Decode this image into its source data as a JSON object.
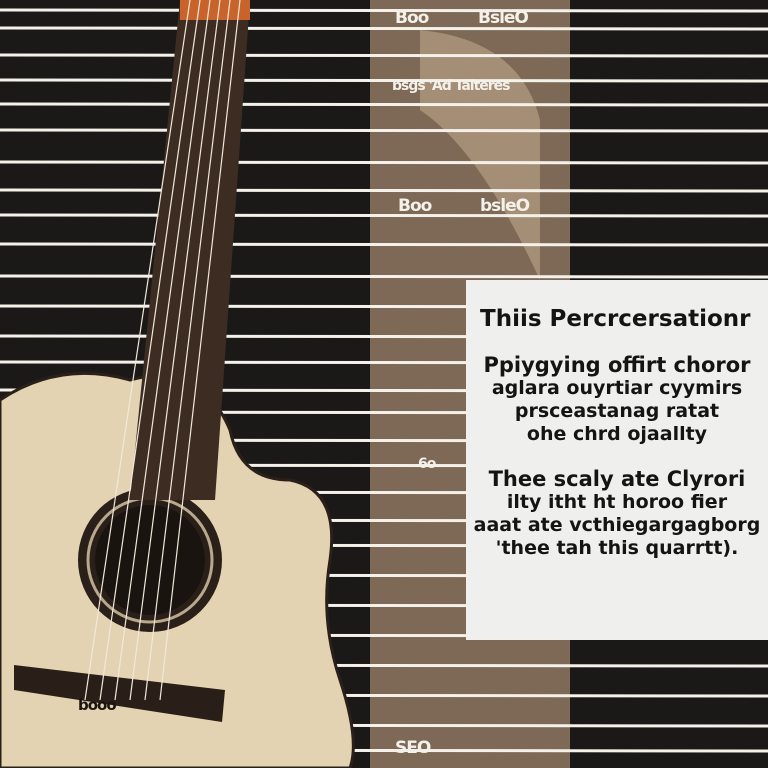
{
  "staff_labels": [
    "Boo",
    "BsleO",
    "bsgs 'Ad Taiteres",
    "Boo",
    "bsleO",
    "6o",
    "booo",
    "SEO"
  ],
  "panel": {
    "title": "Thiis Percrcersationr",
    "paragraph1": [
      "Ppiygying  offirt choror",
      "aglara  ouyrtiar cyymirs",
      "prsceastanag ratat",
      "ohe chrd  ojaallty"
    ],
    "paragraph2": [
      "Thee scaly ate  Clyrori",
      "ilty itht ht horoo fier",
      "aaat ate vcthiegargagborg",
      "'thee tah this quarrtt)."
    ]
  },
  "colors": {
    "background": "#1b1918",
    "wall": "#8a7460",
    "guitar_top": "#e7d6b6",
    "panel": "#efefee",
    "lines": "#f4f1ea"
  }
}
